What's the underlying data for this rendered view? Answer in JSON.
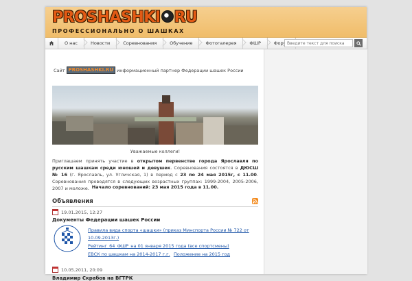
{
  "header": {
    "logo_left": "PROSHASHKI",
    "logo_right": "RU",
    "tagline": "ПРОФЕССИОНАЛЬНО О ШАШКАХ"
  },
  "nav": {
    "items": [
      "О нас",
      "Новости",
      "Соревнования",
      "Обучение",
      "Фотогалерея",
      "ФШР",
      "Форум"
    ],
    "search_placeholder": "Введите текст для поиска"
  },
  "main": {
    "partner_prefix": "Сайт",
    "partner_logo": "PROSHASHKI.RU",
    "partner_suffix": "информационный партнер Федерации шашек России",
    "welcome": "Уважаемые коллеги!",
    "invite_1": "Приглашаем принять участие в",
    "invite_bold_1": "открытом первенстве города Ярославля по русским шашкам среди юношей и девушек",
    "invite_2": ". Соревнования состоятся в",
    "invite_bold_2": "ДЮСШ № 16",
    "invite_3": "(г. Ярославль, ул. Угличская, 1) в период с",
    "invite_bold_3": "23 по 24 мая 2015г, с 11.00",
    "invite_4": ". Соревнования проводятся в следующих возрастных группах: 1999-2004, 2005-2006, 2007 и моложе.",
    "start": "Начало соревнований: 23 мая 2015 года в 11.00.",
    "section_title": "Объявления",
    "posts": [
      {
        "date": "19.01.2015, 12:27",
        "title": "Документы Федерации шашек России",
        "links": [
          "Правила вида спорта «шашки» (приказ Минспорта России № 722 от",
          "10.09.2013г.)",
          "Рейтинг_64_ФШР_на 01 января 2015 года (все спортсмены)",
          "ЕВСК по шашкам на 2014-2017 г.г.",
          "Положение на 2015 год"
        ]
      },
      {
        "date": "10.05.2011, 20:09",
        "title": "Владимир Скрабов на ВГТРК"
      }
    ]
  }
}
